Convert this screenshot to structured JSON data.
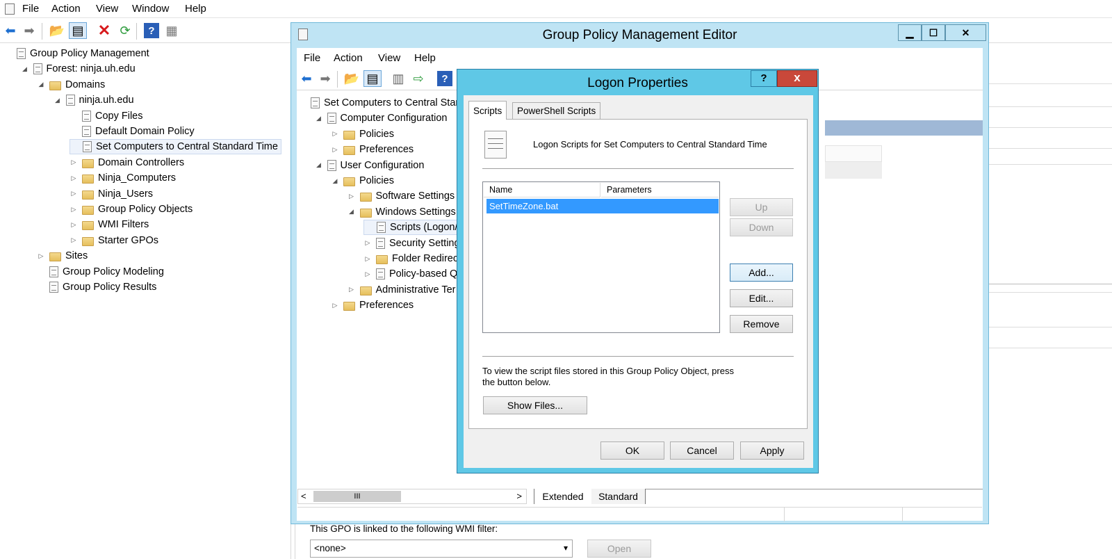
{
  "main_window": {
    "menu": [
      "File",
      "Action",
      "View",
      "Window",
      "Help"
    ],
    "tree": [
      {
        "label": "Group Policy Management",
        "level": 0,
        "icon": "gpm-icon",
        "twisty": ""
      },
      {
        "label": "Forest: ninja.uh.edu",
        "level": 1,
        "icon": "forest-icon",
        "twisty": "◢"
      },
      {
        "label": "Domains",
        "level": 2,
        "icon": "domains-icon",
        "twisty": "◢"
      },
      {
        "label": "ninja.uh.edu",
        "level": 3,
        "icon": "domain-icon",
        "twisty": "◢"
      },
      {
        "label": "Copy Files",
        "level": 4,
        "icon": "gpo-link-icon",
        "twisty": ""
      },
      {
        "label": "Default Domain Policy",
        "level": 4,
        "icon": "gpo-link-icon",
        "twisty": ""
      },
      {
        "label": "Set Computers to Central Standard Time",
        "level": 4,
        "icon": "gpo-link-icon",
        "twisty": "",
        "selected": true
      },
      {
        "label": "Domain Controllers",
        "level": 4,
        "icon": "ou-icon",
        "twisty": "▷"
      },
      {
        "label": "Ninja_Computers",
        "level": 4,
        "icon": "ou-icon",
        "twisty": "▷"
      },
      {
        "label": "Ninja_Users",
        "level": 4,
        "icon": "ou-icon",
        "twisty": "▷"
      },
      {
        "label": "Group Policy Objects",
        "level": 4,
        "icon": "gpo-folder-icon",
        "twisty": "▷"
      },
      {
        "label": "WMI Filters",
        "level": 4,
        "icon": "wmi-folder-icon",
        "twisty": "▷"
      },
      {
        "label": "Starter GPOs",
        "level": 4,
        "icon": "starter-folder-icon",
        "twisty": "▷"
      },
      {
        "label": "Sites",
        "level": 2,
        "icon": "sites-icon",
        "twisty": "▷"
      },
      {
        "label": "Group Policy Modeling",
        "level": 2,
        "icon": "modeling-icon",
        "twisty": ""
      },
      {
        "label": "Group Policy Results",
        "level": 2,
        "icon": "results-icon",
        "twisty": ""
      }
    ],
    "wmi_label": "This GPO is linked to the following WMI filter:",
    "wmi_select_value": "<none>",
    "open_button": "Open"
  },
  "editor": {
    "title": "Group Policy Management Editor",
    "menu": [
      "File",
      "Action",
      "View",
      "Help"
    ],
    "tree": [
      {
        "label": "Set Computers to Central Star",
        "level": 0,
        "icon": "gpo-icon",
        "twisty": ""
      },
      {
        "label": "Computer Configuration",
        "level": 1,
        "icon": "computer-config-icon",
        "twisty": "◢"
      },
      {
        "label": "Policies",
        "level": 2,
        "icon": "folder-icon",
        "twisty": "▷"
      },
      {
        "label": "Preferences",
        "level": 2,
        "icon": "folder-icon",
        "twisty": "▷"
      },
      {
        "label": "User Configuration",
        "level": 1,
        "icon": "user-config-icon",
        "twisty": "◢"
      },
      {
        "label": "Policies",
        "level": 2,
        "icon": "folder-icon",
        "twisty": "◢"
      },
      {
        "label": "Software Settings",
        "level": 3,
        "icon": "folder-icon",
        "twisty": "▷"
      },
      {
        "label": "Windows Settings",
        "level": 3,
        "icon": "folder-icon",
        "twisty": "◢"
      },
      {
        "label": "Scripts (Logon/",
        "level": 4,
        "icon": "scripts-icon",
        "twisty": "",
        "selected": true
      },
      {
        "label": "Security Setting",
        "level": 4,
        "icon": "security-icon",
        "twisty": "▷"
      },
      {
        "label": "Folder Redirect",
        "level": 4,
        "icon": "folder-icon",
        "twisty": "▷"
      },
      {
        "label": "Policy-based Q",
        "level": 4,
        "icon": "qos-icon",
        "twisty": "▷"
      },
      {
        "label": "Administrative Ter",
        "level": 3,
        "icon": "folder-icon",
        "twisty": "▷"
      },
      {
        "label": "Preferences",
        "level": 2,
        "icon": "folder-icon",
        "twisty": "▷"
      }
    ],
    "bottom_tabs": [
      "Extended",
      "Standard"
    ],
    "hscroll_grip": "III"
  },
  "dialog": {
    "title": "Logon Properties",
    "help": "?",
    "close": "x",
    "tabs": [
      "Scripts",
      "PowerShell Scripts"
    ],
    "description": "Logon Scripts for Set Computers to Central Standard Time",
    "columns": [
      "Name",
      "Parameters"
    ],
    "scripts": [
      {
        "name": "SetTimeZone.bat",
        "params": ""
      }
    ],
    "buttons": {
      "up": "Up",
      "down": "Down",
      "add": "Add...",
      "edit": "Edit...",
      "remove": "Remove"
    },
    "info_text": "To view the script files stored in this Group Policy Object, press the button below.",
    "show_files": "Show Files...",
    "ok": "OK",
    "cancel": "Cancel",
    "apply": "Apply"
  }
}
